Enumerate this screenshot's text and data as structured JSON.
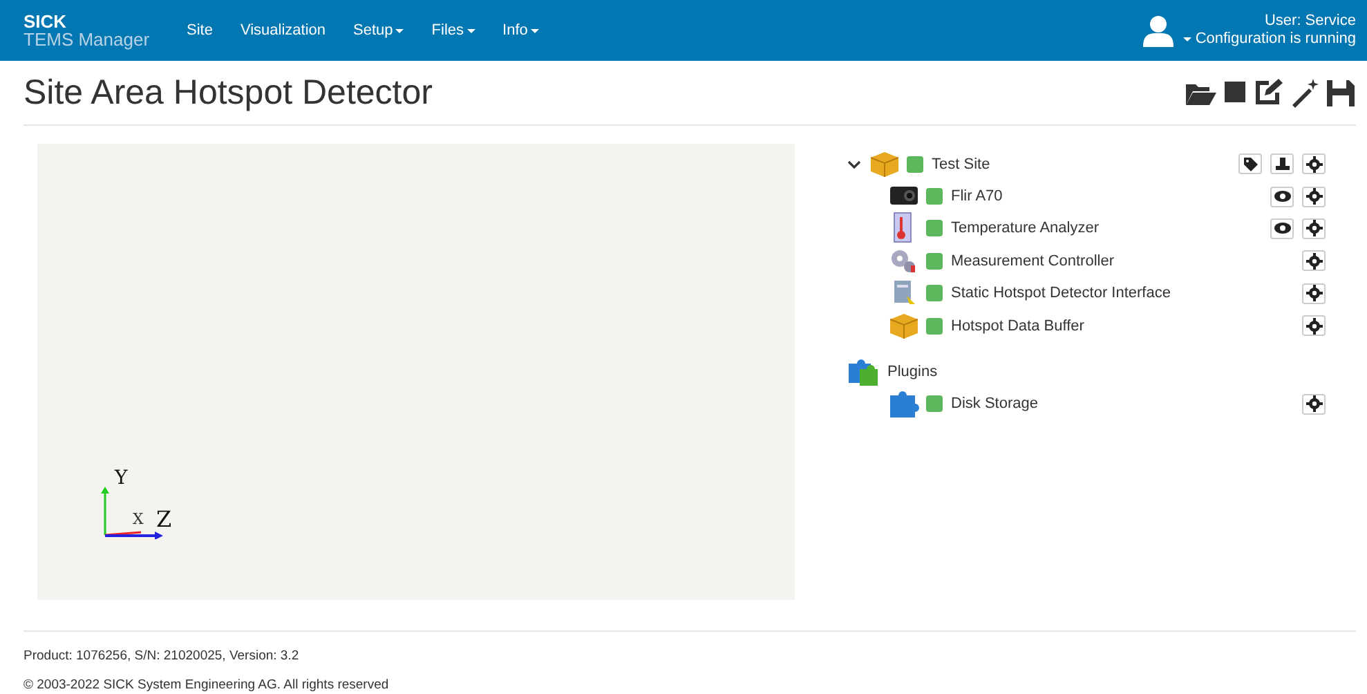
{
  "header": {
    "brand": "SICK",
    "product": "TEMS Manager",
    "menu": [
      {
        "label": "Site",
        "dropdown": false
      },
      {
        "label": "Visualization",
        "dropdown": false
      },
      {
        "label": "Setup",
        "dropdown": true
      },
      {
        "label": "Files",
        "dropdown": true
      },
      {
        "label": "Info",
        "dropdown": true
      }
    ],
    "user": "User: Service",
    "status": "Configuration is running"
  },
  "title": "Site Area Hotspot Detector",
  "viewport": {
    "axes": {
      "y": "Y",
      "x": "X",
      "z": "Z"
    }
  },
  "tree": [
    {
      "label": "Test Site",
      "kind": "box",
      "expanded": true,
      "color": "#5cb85c",
      "actions": [
        {
          "kind": "tag"
        },
        {
          "kind": "stamp"
        },
        {
          "kind": "gear"
        }
      ],
      "children": [
        {
          "label": "Flir A70",
          "kind": "camera",
          "color": "#5cb85c",
          "actions": [
            {
              "kind": "eye"
            },
            {
              "kind": "gear"
            }
          ]
        },
        {
          "label": "Temperature Analyzer",
          "kind": "thermometer",
          "color": "#5cb85c",
          "actions": [
            {
              "kind": "eye"
            },
            {
              "kind": "gear"
            }
          ]
        },
        {
          "label": "Measurement Controller",
          "kind": "gears",
          "color": "#5cb85c",
          "actions": [
            {
              "kind": "gear"
            }
          ]
        },
        {
          "label": "Static Hotspot Detector Interface",
          "kind": "server",
          "color": "#5cb85c",
          "actions": [
            {
              "kind": "gear"
            }
          ]
        },
        {
          "label": "Hotspot Data Buffer",
          "kind": "box",
          "color": "#5cb85c",
          "actions": [
            {
              "kind": "gear"
            }
          ]
        }
      ]
    },
    {
      "label": "Plugins",
      "kind": "plugins",
      "children": [
        {
          "label": "Disk Storage",
          "kind": "puzzle",
          "color": "#5cb85c",
          "actions": [
            {
              "kind": "gear"
            }
          ]
        }
      ]
    }
  ],
  "footer": {
    "product": "Product: 1076256, S/N: 21020025, Version: 3.2",
    "copyright": "© 2003-2022 SICK System Engineering AG. All rights reserved"
  }
}
